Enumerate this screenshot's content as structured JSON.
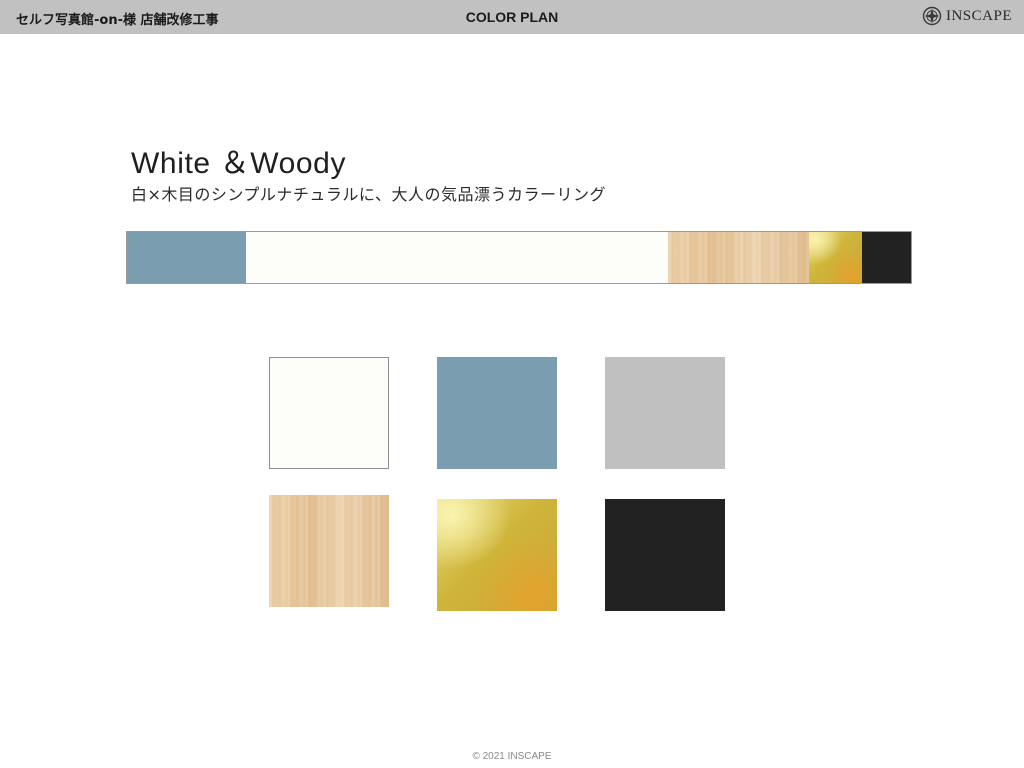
{
  "header": {
    "project": "セルフ写真館-on-様 店舗改修工事",
    "section": "COLOR PLAN",
    "brand": "INSCAPE",
    "brand_icon": "inscape-emblem-icon"
  },
  "main": {
    "title": "White ＆Woody",
    "subtitle": "白×木目のシンプルナチュラルに、大人の気品漂うカラーリング"
  },
  "palette": {
    "white": "#fdfdf9",
    "blue_grey": "#7a9eb0",
    "light_grey": "#c0c0c0",
    "wood": "#e6c69b",
    "gold": "#cdb43a",
    "black": "#222222"
  },
  "footer": {
    "copyright": "© 2021 INSCAPE"
  }
}
